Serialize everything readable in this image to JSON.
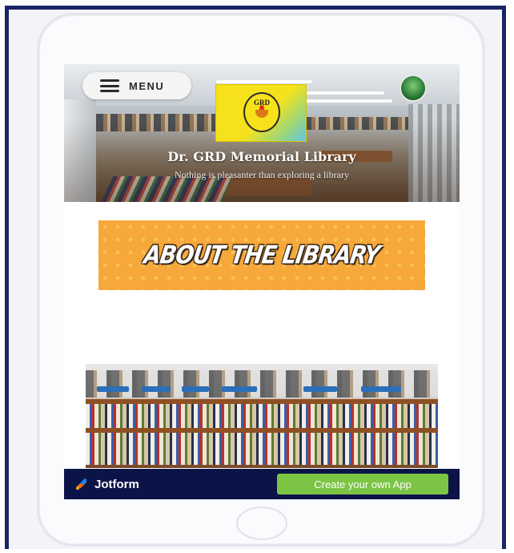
{
  "header": {
    "menu_label": "MENU",
    "title": "Dr. GRD Memorial Library",
    "subtitle": "Nothing is pleasanter than exploring a library"
  },
  "logo": {
    "text": "GRD"
  },
  "about": {
    "banner_text": "ABOUT THE LIBRARY"
  },
  "footer": {
    "brand": "Jotform",
    "cta_label": "Create your own App"
  },
  "icons": {
    "menu": "hamburger-icon",
    "profile": "avatar",
    "brand": "jotform-logo-icon"
  },
  "colors": {
    "frame": "#1a2566",
    "banner": "#f7a83a",
    "footer_bar": "#0b1447",
    "cta": "#7cc444"
  }
}
